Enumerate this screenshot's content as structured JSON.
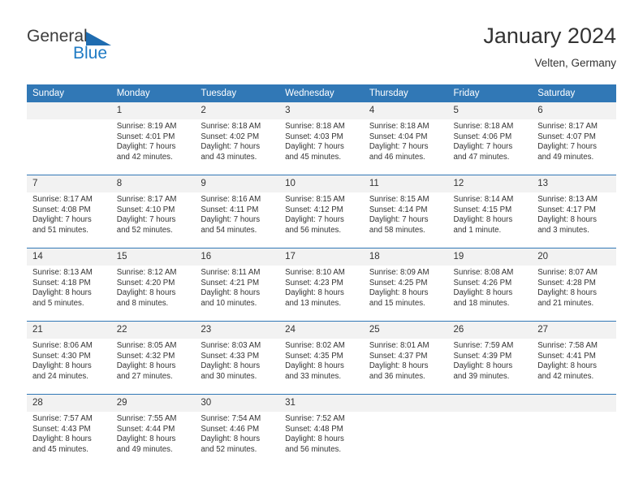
{
  "logo": {
    "word1": "General",
    "word2": "Blue",
    "triangle_color": "#1f6cb0",
    "blue_color": "#1f7bc4"
  },
  "header": {
    "title": "January 2024",
    "location": "Velten, Germany"
  },
  "theme": {
    "header_bg": "#3178b6",
    "daynum_bg": "#f2f2f2",
    "text": "#333333"
  },
  "weekday_headers": [
    "Sunday",
    "Monday",
    "Tuesday",
    "Wednesday",
    "Thursday",
    "Friday",
    "Saturday"
  ],
  "weeks": [
    [
      {
        "day": "",
        "blank": true,
        "l1": "",
        "l2": "",
        "l3": "",
        "l4": ""
      },
      {
        "day": "1",
        "l1": "Sunrise: 8:19 AM",
        "l2": "Sunset: 4:01 PM",
        "l3": "Daylight: 7 hours",
        "l4": "and 42 minutes."
      },
      {
        "day": "2",
        "l1": "Sunrise: 8:18 AM",
        "l2": "Sunset: 4:02 PM",
        "l3": "Daylight: 7 hours",
        "l4": "and 43 minutes."
      },
      {
        "day": "3",
        "l1": "Sunrise: 8:18 AM",
        "l2": "Sunset: 4:03 PM",
        "l3": "Daylight: 7 hours",
        "l4": "and 45 minutes."
      },
      {
        "day": "4",
        "l1": "Sunrise: 8:18 AM",
        "l2": "Sunset: 4:04 PM",
        "l3": "Daylight: 7 hours",
        "l4": "and 46 minutes."
      },
      {
        "day": "5",
        "l1": "Sunrise: 8:18 AM",
        "l2": "Sunset: 4:06 PM",
        "l3": "Daylight: 7 hours",
        "l4": "and 47 minutes."
      },
      {
        "day": "6",
        "l1": "Sunrise: 8:17 AM",
        "l2": "Sunset: 4:07 PM",
        "l3": "Daylight: 7 hours",
        "l4": "and 49 minutes."
      }
    ],
    [
      {
        "day": "7",
        "l1": "Sunrise: 8:17 AM",
        "l2": "Sunset: 4:08 PM",
        "l3": "Daylight: 7 hours",
        "l4": "and 51 minutes."
      },
      {
        "day": "8",
        "l1": "Sunrise: 8:17 AM",
        "l2": "Sunset: 4:10 PM",
        "l3": "Daylight: 7 hours",
        "l4": "and 52 minutes."
      },
      {
        "day": "9",
        "l1": "Sunrise: 8:16 AM",
        "l2": "Sunset: 4:11 PM",
        "l3": "Daylight: 7 hours",
        "l4": "and 54 minutes."
      },
      {
        "day": "10",
        "l1": "Sunrise: 8:15 AM",
        "l2": "Sunset: 4:12 PM",
        "l3": "Daylight: 7 hours",
        "l4": "and 56 minutes."
      },
      {
        "day": "11",
        "l1": "Sunrise: 8:15 AM",
        "l2": "Sunset: 4:14 PM",
        "l3": "Daylight: 7 hours",
        "l4": "and 58 minutes."
      },
      {
        "day": "12",
        "l1": "Sunrise: 8:14 AM",
        "l2": "Sunset: 4:15 PM",
        "l3": "Daylight: 8 hours",
        "l4": "and 1 minute."
      },
      {
        "day": "13",
        "l1": "Sunrise: 8:13 AM",
        "l2": "Sunset: 4:17 PM",
        "l3": "Daylight: 8 hours",
        "l4": "and 3 minutes."
      }
    ],
    [
      {
        "day": "14",
        "l1": "Sunrise: 8:13 AM",
        "l2": "Sunset: 4:18 PM",
        "l3": "Daylight: 8 hours",
        "l4": "and 5 minutes."
      },
      {
        "day": "15",
        "l1": "Sunrise: 8:12 AM",
        "l2": "Sunset: 4:20 PM",
        "l3": "Daylight: 8 hours",
        "l4": "and 8 minutes."
      },
      {
        "day": "16",
        "l1": "Sunrise: 8:11 AM",
        "l2": "Sunset: 4:21 PM",
        "l3": "Daylight: 8 hours",
        "l4": "and 10 minutes."
      },
      {
        "day": "17",
        "l1": "Sunrise: 8:10 AM",
        "l2": "Sunset: 4:23 PM",
        "l3": "Daylight: 8 hours",
        "l4": "and 13 minutes."
      },
      {
        "day": "18",
        "l1": "Sunrise: 8:09 AM",
        "l2": "Sunset: 4:25 PM",
        "l3": "Daylight: 8 hours",
        "l4": "and 15 minutes."
      },
      {
        "day": "19",
        "l1": "Sunrise: 8:08 AM",
        "l2": "Sunset: 4:26 PM",
        "l3": "Daylight: 8 hours",
        "l4": "and 18 minutes."
      },
      {
        "day": "20",
        "l1": "Sunrise: 8:07 AM",
        "l2": "Sunset: 4:28 PM",
        "l3": "Daylight: 8 hours",
        "l4": "and 21 minutes."
      }
    ],
    [
      {
        "day": "21",
        "l1": "Sunrise: 8:06 AM",
        "l2": "Sunset: 4:30 PM",
        "l3": "Daylight: 8 hours",
        "l4": "and 24 minutes."
      },
      {
        "day": "22",
        "l1": "Sunrise: 8:05 AM",
        "l2": "Sunset: 4:32 PM",
        "l3": "Daylight: 8 hours",
        "l4": "and 27 minutes."
      },
      {
        "day": "23",
        "l1": "Sunrise: 8:03 AM",
        "l2": "Sunset: 4:33 PM",
        "l3": "Daylight: 8 hours",
        "l4": "and 30 minutes."
      },
      {
        "day": "24",
        "l1": "Sunrise: 8:02 AM",
        "l2": "Sunset: 4:35 PM",
        "l3": "Daylight: 8 hours",
        "l4": "and 33 minutes."
      },
      {
        "day": "25",
        "l1": "Sunrise: 8:01 AM",
        "l2": "Sunset: 4:37 PM",
        "l3": "Daylight: 8 hours",
        "l4": "and 36 minutes."
      },
      {
        "day": "26",
        "l1": "Sunrise: 7:59 AM",
        "l2": "Sunset: 4:39 PM",
        "l3": "Daylight: 8 hours",
        "l4": "and 39 minutes."
      },
      {
        "day": "27",
        "l1": "Sunrise: 7:58 AM",
        "l2": "Sunset: 4:41 PM",
        "l3": "Daylight: 8 hours",
        "l4": "and 42 minutes."
      }
    ],
    [
      {
        "day": "28",
        "l1": "Sunrise: 7:57 AM",
        "l2": "Sunset: 4:43 PM",
        "l3": "Daylight: 8 hours",
        "l4": "and 45 minutes."
      },
      {
        "day": "29",
        "l1": "Sunrise: 7:55 AM",
        "l2": "Sunset: 4:44 PM",
        "l3": "Daylight: 8 hours",
        "l4": "and 49 minutes."
      },
      {
        "day": "30",
        "l1": "Sunrise: 7:54 AM",
        "l2": "Sunset: 4:46 PM",
        "l3": "Daylight: 8 hours",
        "l4": "and 52 minutes."
      },
      {
        "day": "31",
        "l1": "Sunrise: 7:52 AM",
        "l2": "Sunset: 4:48 PM",
        "l3": "Daylight: 8 hours",
        "l4": "and 56 minutes."
      },
      {
        "day": "",
        "blank": true,
        "l1": "",
        "l2": "",
        "l3": "",
        "l4": ""
      },
      {
        "day": "",
        "blank": true,
        "l1": "",
        "l2": "",
        "l3": "",
        "l4": ""
      },
      {
        "day": "",
        "blank": true,
        "l1": "",
        "l2": "",
        "l3": "",
        "l4": ""
      }
    ]
  ]
}
